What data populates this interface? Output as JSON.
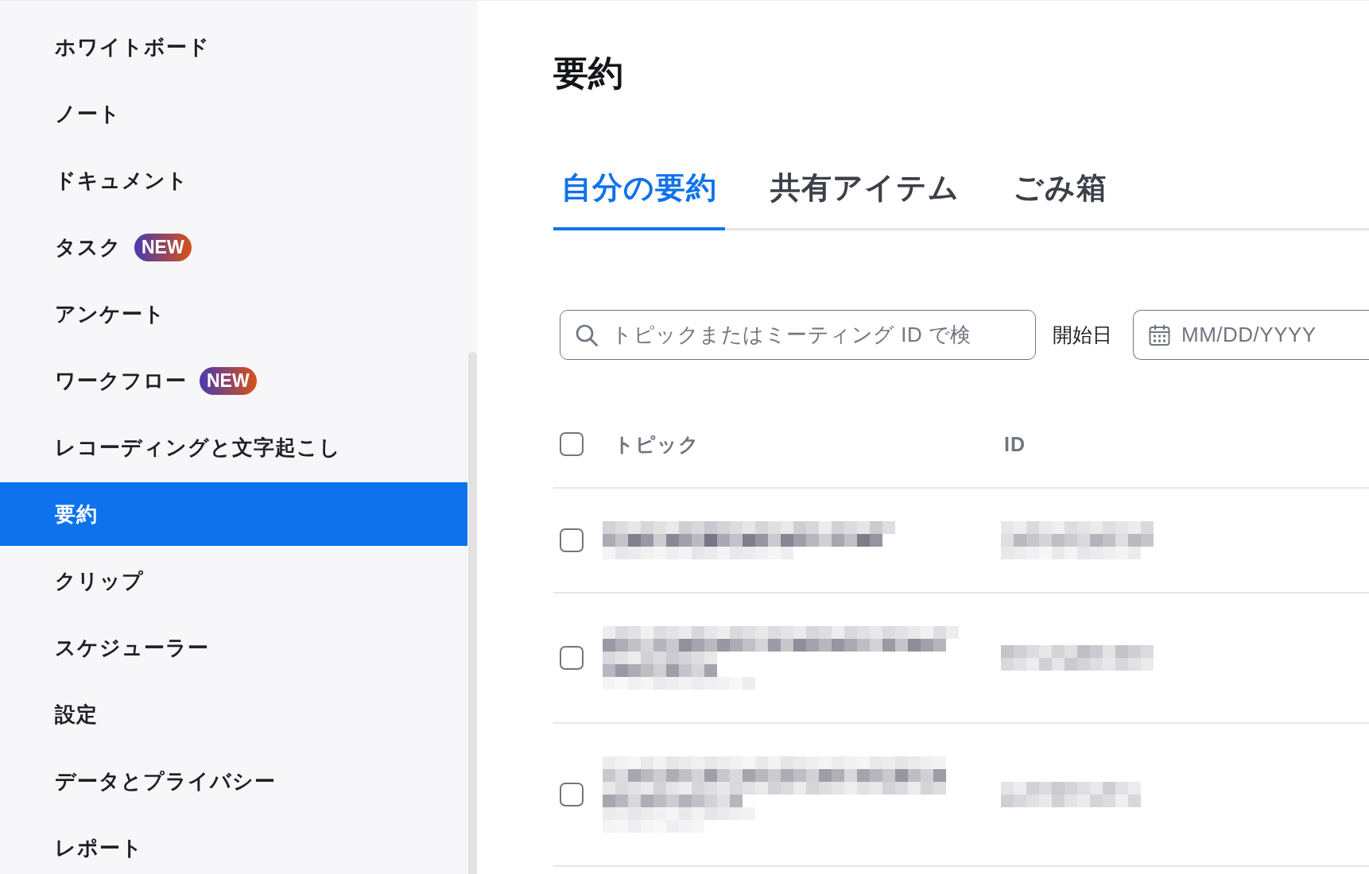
{
  "sidebar": {
    "items": [
      {
        "label": "ホワイトボード",
        "selected": false
      },
      {
        "label": "ノート",
        "selected": false
      },
      {
        "label": "ドキュメント",
        "selected": false
      },
      {
        "label": "タスク",
        "selected": false,
        "badge": "NEW"
      },
      {
        "label": "アンケート",
        "selected": false
      },
      {
        "label": "ワークフロー",
        "selected": false,
        "badge": "NEW"
      },
      {
        "label": "レコーディングと文字起こし",
        "selected": false
      },
      {
        "label": "要約",
        "selected": true
      },
      {
        "label": "クリップ",
        "selected": false
      },
      {
        "label": "スケジューラー",
        "selected": false
      },
      {
        "label": "設定",
        "selected": false
      },
      {
        "label": "データとプライバシー",
        "selected": false
      },
      {
        "label": "レポート",
        "selected": false
      }
    ]
  },
  "page_title": "要約",
  "tabs": [
    {
      "label": "自分の要約",
      "selected": true
    },
    {
      "label": "共有アイテム",
      "selected": false
    },
    {
      "label": "ごみ箱",
      "selected": false
    }
  ],
  "search": {
    "placeholder": "トピックまたはミーティング ID で検"
  },
  "date_filter": {
    "label": "開始日",
    "placeholder": "MM/DD/YYYY"
  },
  "table": {
    "select_all": {
      "checked": false
    },
    "columns": [
      "トピック",
      "ID"
    ],
    "rows": [
      {
        "checked": false
      },
      {
        "checked": false
      },
      {
        "checked": false
      }
    ]
  }
}
